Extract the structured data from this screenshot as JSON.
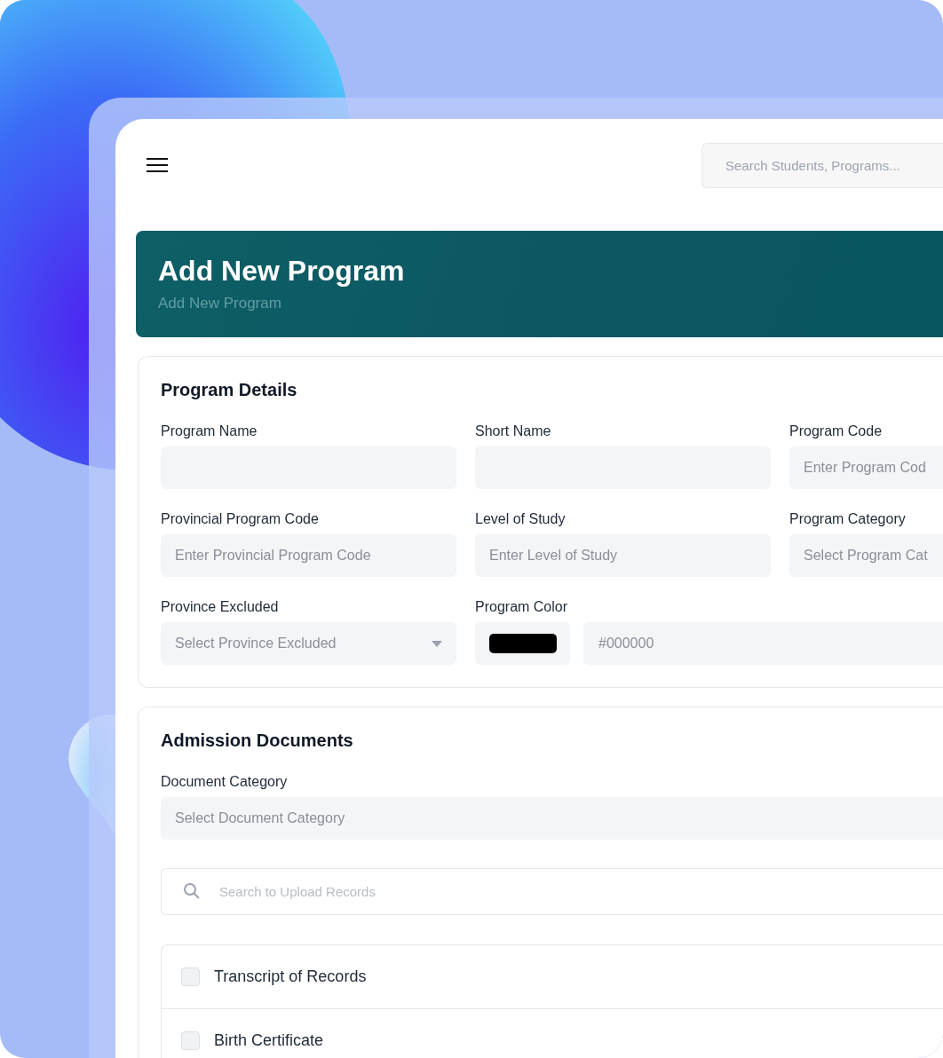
{
  "header": {
    "search": {
      "placeholder": "Search Students, Programs..."
    }
  },
  "banner": {
    "title": "Add New Program",
    "breadcrumb": "Add New Program"
  },
  "program_details": {
    "title": "Program Details",
    "fields": [
      {
        "label": "Program Name",
        "kind": "text"
      },
      {
        "label": "Short Name",
        "kind": "text"
      },
      {
        "label": "Program Code",
        "kind": "text",
        "placeholder": "Enter Program Cod"
      },
      {
        "label": "Provincial Program Code",
        "kind": "text",
        "placeholder": "Enter Provincial Program Code"
      },
      {
        "label": "Level of Study",
        "kind": "text",
        "placeholder": "Enter Level of Study"
      },
      {
        "label": "Program Category",
        "kind": "select",
        "placeholder": "Select Program Cat"
      },
      {
        "label": "Province Excluded",
        "kind": "select",
        "placeholder": "Select Province Excluded",
        "caret": true
      },
      {
        "label": "Program Color",
        "kind": "color",
        "color": "#000000",
        "placeholder": "#000000"
      }
    ]
  },
  "admission_documents": {
    "title": "Admission Documents",
    "category": {
      "label": "Document Category",
      "placeholder": "Select Document Category"
    },
    "search": {
      "placeholder": "Search to Upload Records"
    },
    "documents": [
      {
        "name": "Transcript of Records",
        "checked": false
      },
      {
        "name": "Birth Certificate",
        "checked": false
      }
    ]
  }
}
